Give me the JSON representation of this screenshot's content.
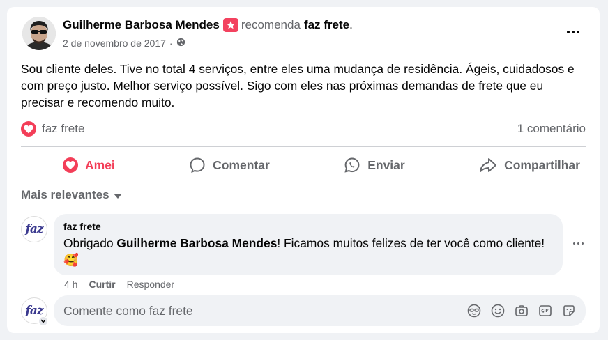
{
  "post": {
    "author": "Guilherme Barbosa Mendes",
    "recommends": "recomenda",
    "page": "faz frete",
    "period": ".",
    "date": "2 de novembro de 2017",
    "separator": "·",
    "text": "Sou cliente deles. Tive no total 4 serviços, entre eles uma mudança de residência. Ágeis, cuidadosos e com preço justo. Melhor serviço possível. Sigo com eles nas próximas demandas de frete que eu precisar e recomendo muito.",
    "reaction_by": "faz frete",
    "comment_count": "1 comentário"
  },
  "actions": {
    "love": "Amei",
    "comment": "Comentar",
    "send": "Enviar",
    "share": "Compartilhar"
  },
  "comments_section": {
    "sort_label": "Mais relevantes"
  },
  "comment": {
    "avatar_text": "faz",
    "author": "faz frete",
    "text_before": "Obrigado ",
    "mention": "Guilherme Barbosa Mendes",
    "text_after": "! Ficamos muitos felizes de ter você como cliente!",
    "emoji": "🥰",
    "time": "4 h",
    "like": "Curtir",
    "reply": "Responder"
  },
  "composer": {
    "avatar_text": "faz",
    "placeholder": "Comente como faz frete"
  },
  "icons": {
    "recommend": "recommend-star-icon",
    "privacy": "globe-icon",
    "more": "more-options-icon",
    "love": "love-icon",
    "comment": "speech-bubble-icon",
    "send": "whatsapp-icon",
    "share": "share-arrow-icon",
    "composer": [
      "avatar-sticker-icon",
      "emoji-icon",
      "camera-icon",
      "gif-icon",
      "sticker-icon"
    ]
  },
  "colors": {
    "love": "#f33e58",
    "text": "#050505",
    "muted": "#65676b",
    "bubble": "#f0f2f5",
    "brand": "#3b3a8f"
  }
}
